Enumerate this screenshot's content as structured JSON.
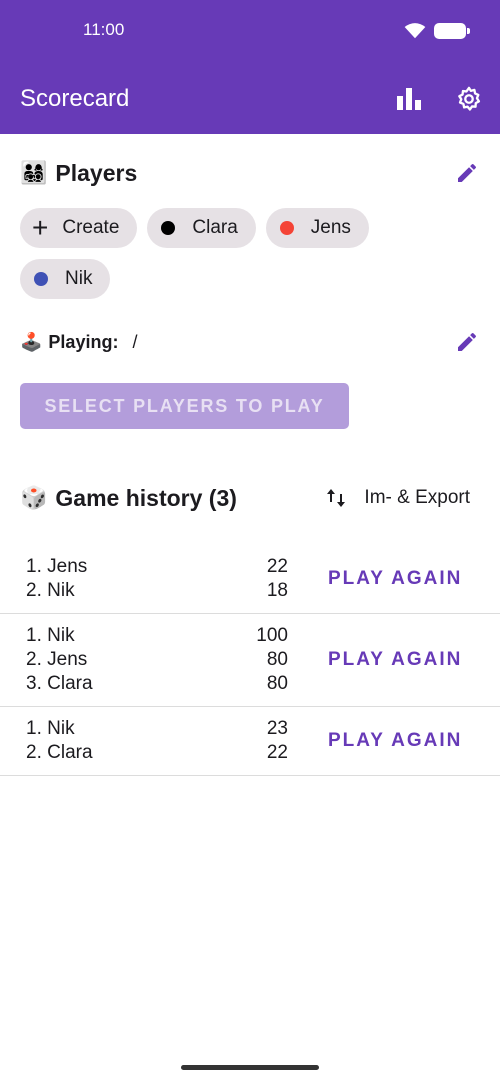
{
  "status_bar": {
    "time": "11:00"
  },
  "app_bar": {
    "title": "Scorecard"
  },
  "players": {
    "heading": "Players",
    "create_label": "Create",
    "list": [
      {
        "name": "Clara",
        "color": "#000000"
      },
      {
        "name": "Jens",
        "color": "#f44336"
      },
      {
        "name": "Nik",
        "color": "#3f51b5"
      }
    ]
  },
  "playing": {
    "label": "Playing:",
    "value": "/"
  },
  "select_button": "SELECT PLAYERS TO PLAY",
  "history": {
    "heading": "Game history (3)",
    "export_label": "Im- & Export",
    "play_again_label": "PLAY AGAIN",
    "games": [
      {
        "results": [
          {
            "rank": "1. Jens",
            "score": "22"
          },
          {
            "rank": "2. Nik",
            "score": "18"
          }
        ]
      },
      {
        "results": [
          {
            "rank": "1. Nik",
            "score": "100"
          },
          {
            "rank": "2. Jens",
            "score": "80"
          },
          {
            "rank": "3. Clara",
            "score": "80"
          }
        ]
      },
      {
        "results": [
          {
            "rank": "1. Nik",
            "score": "23"
          },
          {
            "rank": "2. Clara",
            "score": "22"
          }
        ]
      }
    ]
  },
  "colors": {
    "primary": "#673ab7",
    "primary_disabled": "#b39ddb"
  }
}
